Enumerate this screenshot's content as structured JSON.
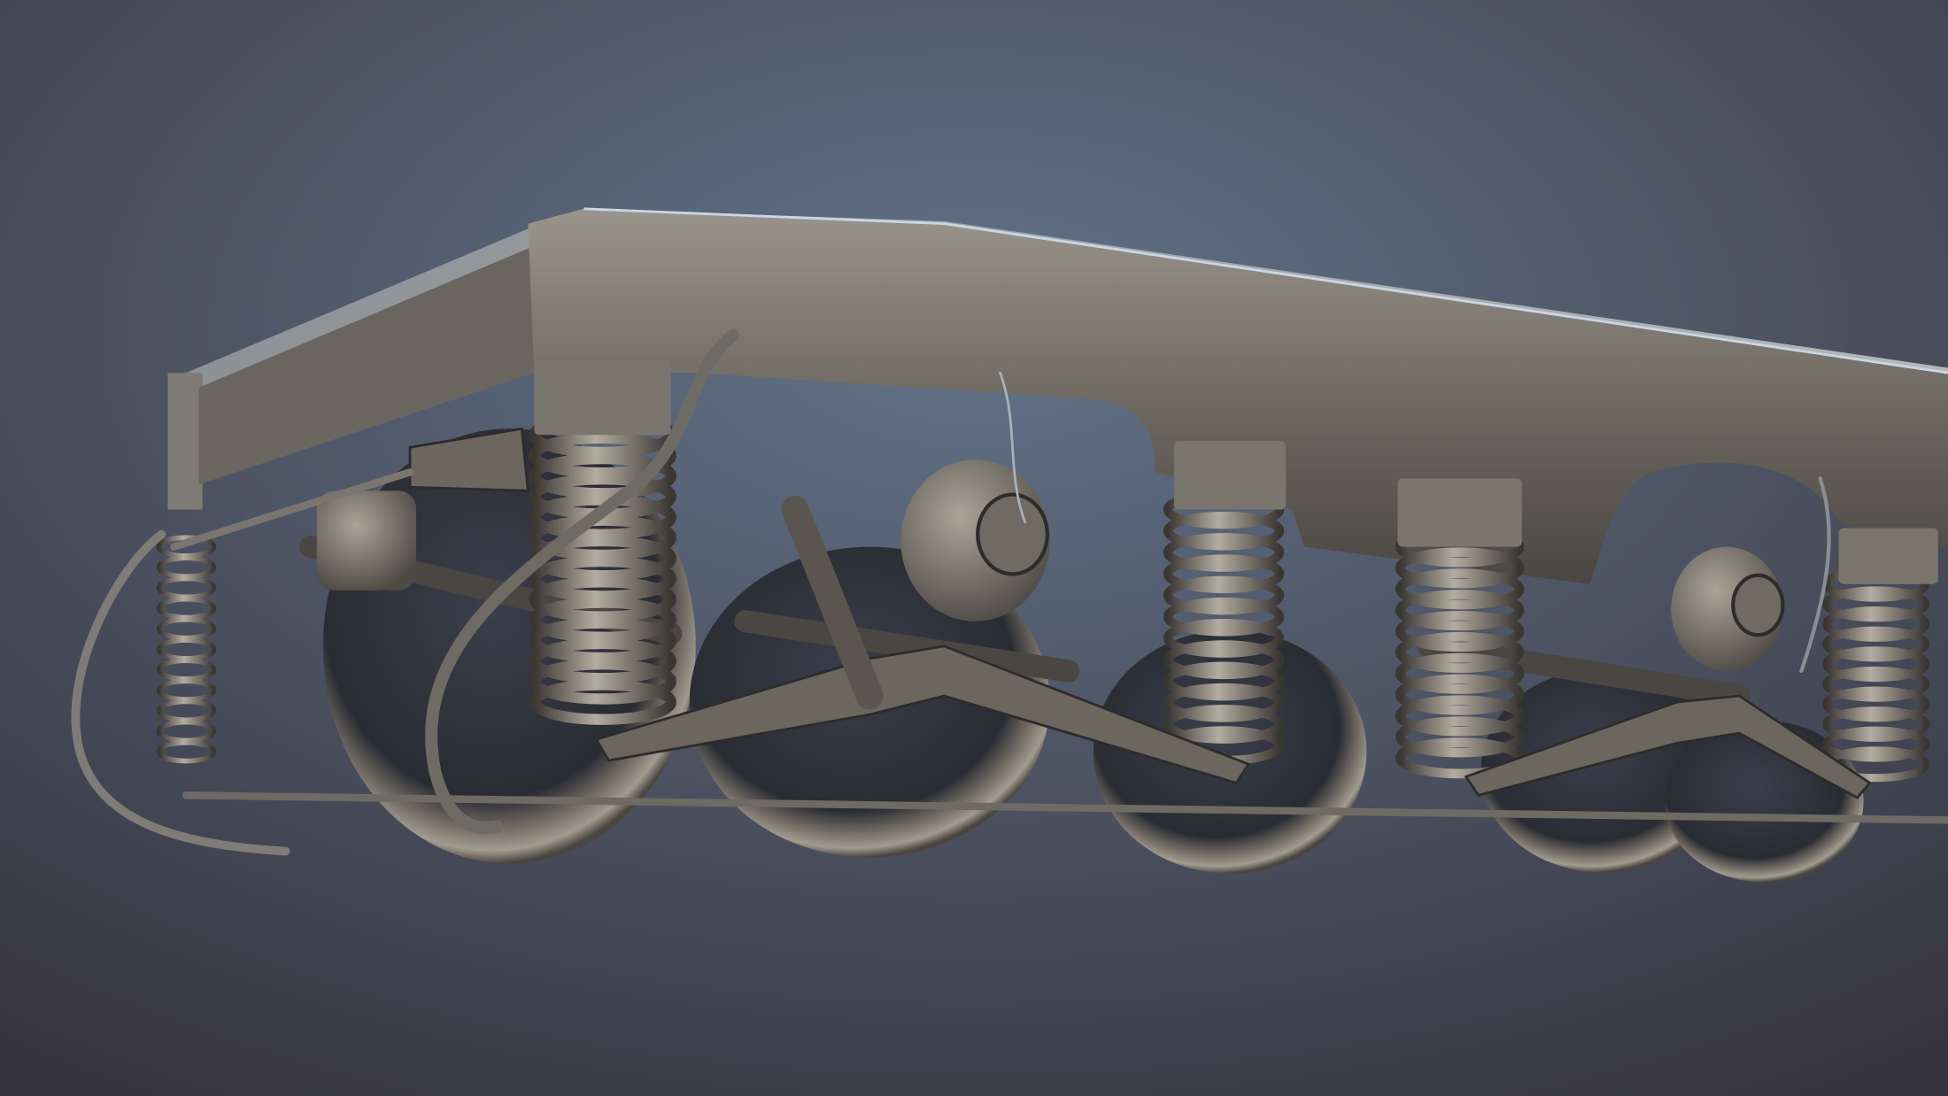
{
  "colors": {
    "background_center": "#5d6d82",
    "background_edge": "#35333d",
    "metal_light": "#8a857c",
    "metal_mid": "#5f5a53",
    "metal_dark": "#2e2c2b",
    "highlight": "#c9d6e6"
  }
}
